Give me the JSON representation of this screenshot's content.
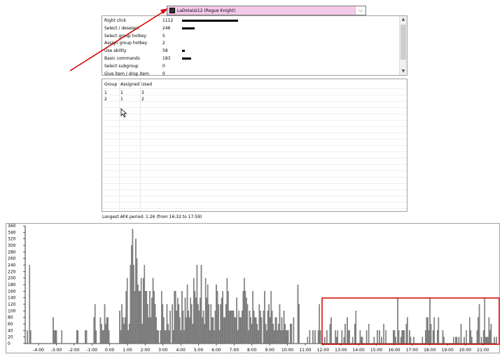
{
  "player_select": {
    "value": "LaDotaUz12 (Rogue Knight)",
    "icon": "hero-portrait-icon",
    "chevron": "⌵"
  },
  "actions": [
    {
      "name": "Right click",
      "count": "1112",
      "bar": 1.0
    },
    {
      "name": "Select / deselect",
      "count": "246",
      "bar": 0.22
    },
    {
      "name": "Select group hotkey",
      "count": "5",
      "bar": 0
    },
    {
      "name": "Assign group hotkey",
      "count": "2",
      "bar": 0
    },
    {
      "name": "Use ability",
      "count": "58",
      "bar": 0.05
    },
    {
      "name": "Basic commands",
      "count": "183",
      "bar": 0.16
    },
    {
      "name": "Select subgroup",
      "count": "0",
      "bar": 0
    },
    {
      "name": "Give item / drop item",
      "count": "0",
      "bar": 0
    }
  ],
  "groups": {
    "headers": [
      "Group",
      "Assigned",
      "Used"
    ],
    "rows": [
      [
        "1",
        "1",
        "3"
      ],
      [
        "2",
        "1",
        "2"
      ]
    ]
  },
  "afk_text": "Longest AFK period: 1:26 (from 16:32 to 17:59)",
  "chart_data": {
    "type": "bar",
    "yticks": [
      "360",
      "340",
      "320",
      "300",
      "280",
      "260",
      "240",
      "220",
      "200",
      "180",
      "160",
      "140",
      "120",
      "100",
      "80",
      "60",
      "40",
      "20",
      "0"
    ],
    "ylim": [
      0,
      360
    ],
    "xticks": [
      "-4:00",
      "-3:00",
      "-2:00",
      "-1:00",
      "0:00",
      "1:00",
      "2:00",
      "3:00",
      "4:00",
      "5:00",
      "6:00",
      "7:00",
      "8:00",
      "9:00",
      "10:00",
      "11:00",
      "12:00",
      "13:00",
      "14:00",
      "15:00",
      "16:00",
      "17:00",
      "18:00",
      "19:00",
      "20:00",
      "21:00"
    ],
    "xrange_minutes": [
      -4.75,
      21.75
    ],
    "values": [
      0,
      40,
      0,
      240,
      40,
      0,
      0,
      0,
      0,
      0,
      0,
      0,
      0,
      0,
      0,
      0,
      0,
      0,
      0,
      0,
      0,
      0,
      0,
      0,
      0,
      80,
      40,
      40,
      40,
      0,
      0,
      0,
      0,
      40,
      0,
      0,
      0,
      0,
      0,
      0,
      0,
      0,
      0,
      0,
      0,
      0,
      0,
      40,
      40,
      0,
      0,
      0,
      0,
      0,
      0,
      40,
      40,
      0,
      0,
      0,
      0,
      0,
      0,
      80,
      120,
      40,
      0,
      0,
      0,
      80,
      60,
      40,
      40,
      120,
      60,
      80,
      80,
      40,
      0,
      0,
      0,
      0,
      0,
      0,
      0,
      0,
      0,
      100,
      40,
      120,
      80,
      60,
      80,
      160,
      200,
      40,
      60,
      240,
      300,
      350,
      240,
      160,
      320,
      260,
      180,
      160,
      160,
      200,
      60,
      200,
      240,
      160,
      160,
      120,
      80,
      160,
      80,
      140,
      200,
      160,
      120,
      80,
      40,
      40,
      0,
      40,
      160,
      120,
      80,
      40,
      40,
      120,
      60,
      40,
      100,
      0,
      120,
      40,
      160,
      160,
      100,
      140,
      120,
      80,
      40,
      160,
      100,
      40,
      140,
      80,
      180,
      100,
      80,
      140,
      120,
      60,
      200,
      160,
      140,
      240,
      120,
      100,
      140,
      240,
      80,
      100,
      60,
      200,
      140,
      180,
      120,
      40,
      120,
      80,
      80,
      40,
      100,
      180,
      160,
      120,
      40,
      120,
      140,
      160,
      80,
      80,
      120,
      200,
      160,
      100,
      100,
      100,
      100,
      100,
      80,
      80,
      140,
      40,
      100,
      80,
      80,
      100,
      160,
      200,
      160,
      140,
      120,
      40,
      100,
      80,
      60,
      160,
      100,
      80,
      80,
      60,
      40,
      120,
      100,
      80,
      0,
      100,
      160,
      60,
      40,
      100,
      120,
      80,
      160,
      100,
      60,
      40,
      80,
      80,
      40,
      60,
      120,
      40,
      80,
      40,
      100,
      60,
      40,
      40,
      40,
      0,
      60,
      60,
      0,
      80,
      0,
      0,
      0,
      180,
      120,
      0,
      0,
      0,
      0,
      0,
      0,
      0,
      20,
      0,
      40,
      0,
      0,
      40,
      0,
      40,
      0,
      0,
      40,
      120,
      40,
      0,
      0,
      0,
      20,
      0,
      40,
      0,
      0,
      60,
      80,
      0,
      0,
      0,
      40,
      20,
      40,
      0,
      0,
      0,
      40,
      0,
      20,
      60,
      0,
      80,
      40,
      40,
      0,
      0,
      20,
      0,
      60,
      100,
      0,
      0,
      0,
      40,
      20,
      20,
      0,
      0,
      0,
      40,
      0,
      60,
      0,
      0,
      0,
      0,
      20,
      0,
      0,
      40,
      0,
      40,
      0,
      20,
      0,
      60,
      0,
      40,
      0,
      0,
      0,
      0,
      0,
      0,
      40,
      40,
      20,
      0,
      140,
      40,
      0,
      20,
      40,
      40,
      40,
      0,
      60,
      80,
      0,
      40,
      20,
      0,
      0,
      20,
      0,
      0,
      0,
      0,
      0,
      0,
      0,
      20,
      0,
      0,
      40,
      80,
      80,
      40,
      140,
      60,
      0,
      40,
      80,
      0,
      0,
      40,
      80,
      0,
      0,
      0,
      40,
      20,
      0,
      0,
      0,
      0,
      0,
      0,
      0,
      0,
      20,
      0,
      20,
      20,
      0,
      20,
      0,
      60,
      0,
      0,
      20,
      0,
      40,
      0,
      0,
      80,
      40,
      20,
      0,
      0,
      0,
      0,
      40,
      80,
      120,
      0,
      20,
      0,
      40,
      140,
      20,
      20,
      20,
      80,
      40,
      60,
      0,
      0,
      20,
      0,
      20
    ]
  },
  "colors": {
    "bar": "#8a8a8a",
    "dropdown_bg": "#f4c8e8",
    "annotation": "#d40000"
  }
}
